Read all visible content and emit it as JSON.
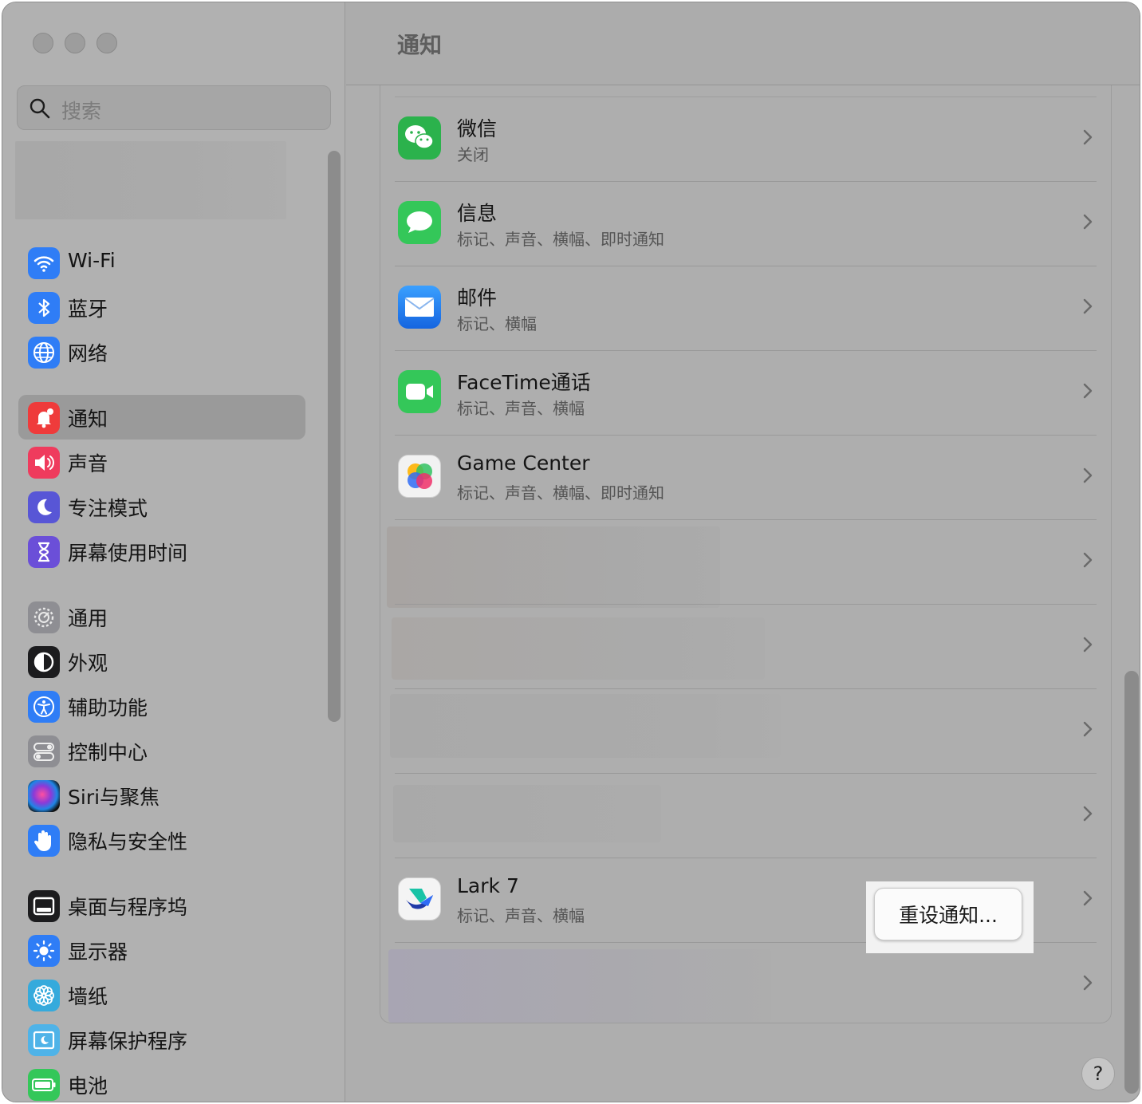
{
  "window": {
    "title": "通知"
  },
  "sidebar": {
    "search_placeholder": "搜索",
    "items": [
      {
        "label": "Wi-Fi",
        "icon": "wifi-icon",
        "color": "#2f7df6"
      },
      {
        "label": "蓝牙",
        "icon": "bluetooth-icon",
        "color": "#2f7df6"
      },
      {
        "label": "网络",
        "icon": "globe-icon",
        "color": "#2f7df6"
      },
      {
        "label": "通知",
        "icon": "bell-icon",
        "color": "#ef3b3b",
        "selected": true
      },
      {
        "label": "声音",
        "icon": "speaker-icon",
        "color": "#ef3b5d"
      },
      {
        "label": "专注模式",
        "icon": "moon-icon",
        "color": "#5856d6"
      },
      {
        "label": "屏幕使用时间",
        "icon": "hourglass-icon",
        "color": "#6b4fd8"
      },
      {
        "label": "通用",
        "icon": "gear-icon",
        "color": "#8e8e93"
      },
      {
        "label": "外观",
        "icon": "appearance-icon",
        "color": "#1c1c1e"
      },
      {
        "label": "辅助功能",
        "icon": "accessibility-icon",
        "color": "#2f7df6"
      },
      {
        "label": "控制中心",
        "icon": "toggles-icon",
        "color": "#8e8e93"
      },
      {
        "label": "Siri与聚焦",
        "icon": "siri-icon",
        "color": "#222"
      },
      {
        "label": "隐私与安全性",
        "icon": "hand-icon",
        "color": "#2f7df6"
      },
      {
        "label": "桌面与程序坞",
        "icon": "dock-icon",
        "color": "#1c1c1e"
      },
      {
        "label": "显示器",
        "icon": "sun-icon",
        "color": "#2f7df6"
      },
      {
        "label": "墙纸",
        "icon": "flower-icon",
        "color": "#35aadc"
      },
      {
        "label": "屏幕保护程序",
        "icon": "screensaver-icon",
        "color": "#4fb3e8"
      },
      {
        "label": "电池",
        "icon": "battery-icon",
        "color": "#34c759"
      }
    ]
  },
  "apps": [
    {
      "name": "微信",
      "sub": "关闭",
      "icon": "wechat-icon",
      "color": "#2bb24c"
    },
    {
      "name": "信息",
      "sub": "标记、声音、横幅、即时通知",
      "icon": "messages-icon",
      "color": "#34c759"
    },
    {
      "name": "邮件",
      "sub": "标记、横幅",
      "icon": "mail-icon",
      "color": "#1e7cf2"
    },
    {
      "name": "FaceTime通话",
      "sub": "标记、声音、横幅",
      "icon": "facetime-icon",
      "color": "#34c759"
    },
    {
      "name": "Game Center",
      "sub": "标记、声音、横幅、即时通知",
      "icon": "game-center-icon",
      "color": "#f2f2f2"
    },
    {
      "name": "",
      "sub": "",
      "blurred": true
    },
    {
      "name": "",
      "sub": "",
      "blurred": true
    },
    {
      "name": "",
      "sub": "",
      "blurred": true
    },
    {
      "name": "",
      "sub": "",
      "blurred": true
    },
    {
      "name": "Lark 7",
      "sub": "标记、声音、横幅",
      "icon": "lark-icon",
      "color": "#f4f4f4"
    },
    {
      "name": "",
      "sub": "",
      "blurred": true
    }
  ],
  "context_menu": {
    "reset_label": "重设通知..."
  },
  "help_label": "?"
}
